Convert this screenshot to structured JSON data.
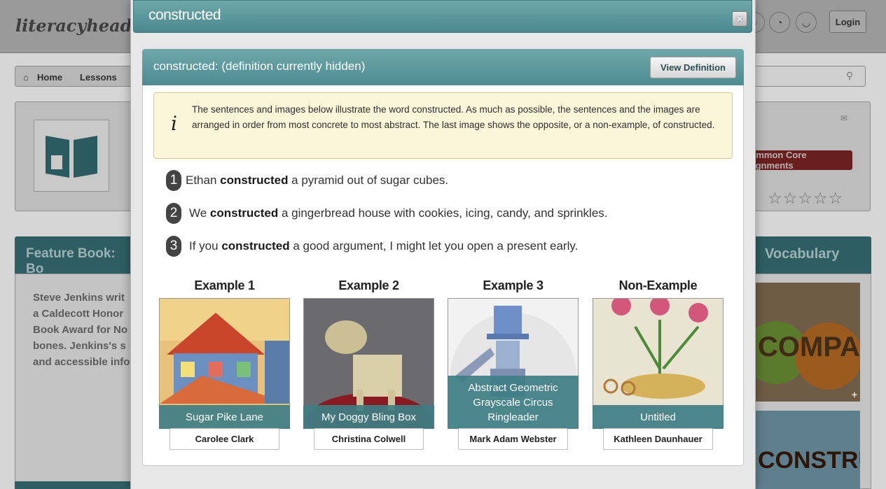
{
  "site": {
    "logo": "literacyhead",
    "login_label": "Login",
    "breadcrumb": {
      "home": "Home",
      "lessons": "Lessons"
    },
    "alignments_label": "Common Core Alignments",
    "feature_title": "Feature Book: Bo",
    "feature_text": "Steve Jenkins writ\na Caldecott Honor\nBook Award for No\nbones. Jenkins's s\nand accessible info",
    "vocab_title": "Vocabulary",
    "vocab_img1_text": "COMPARE",
    "vocab_img2_text": "CONSTRUCTED"
  },
  "modal": {
    "title": "constructed",
    "close_label": "×",
    "panel_title": "constructed: (definition currently hidden)",
    "view_definition_label": "View Definition",
    "info_text": "The sentences and images below illustrate the word constructed. As much as possible, the sentences and the images are arranged in order from most concrete to most abstract. The last image shows the opposite, or a non-example, of constructed.",
    "sentences": [
      {
        "num": "1",
        "pre": "Ethan ",
        "word": "constructed",
        "post": " a pyramid out of sugar cubes."
      },
      {
        "num": "2",
        "pre": "We ",
        "word": "constructed",
        "post": " a gingerbread house with cookies, icing, candy, and sprinkles."
      },
      {
        "num": "3",
        "pre": "If you ",
        "word": "constructed",
        "post": " a good argument, I might let you open a present early."
      }
    ],
    "examples": [
      {
        "label": "Example 1",
        "caption": "Sugar Pike Lane",
        "artist": "Carolee Clark"
      },
      {
        "label": "Example 2",
        "caption": "My Doggy Bling Box",
        "artist": "Christina Colwell"
      },
      {
        "label": "Example 3",
        "caption": "Abstract Geometric Grayscale Circus Ringleader",
        "artist": "Mark Adam Webster"
      },
      {
        "label": "Non-Example",
        "caption": "Untitled",
        "artist": "Kathleen Daunhauer"
      }
    ]
  }
}
